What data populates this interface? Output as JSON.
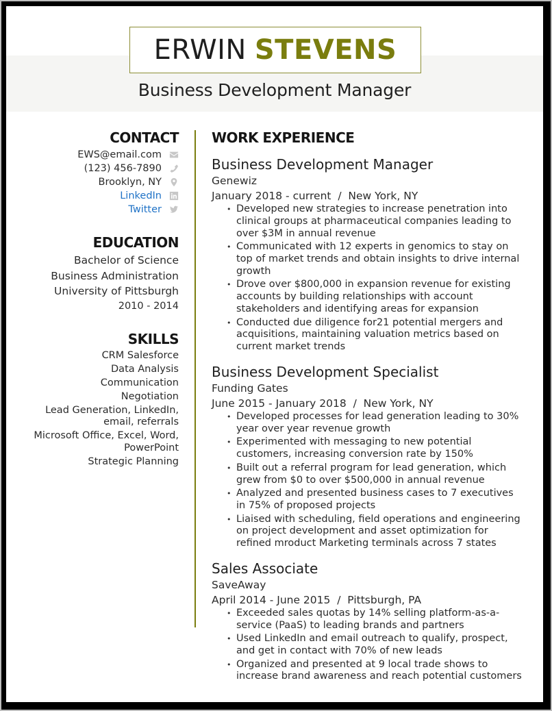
{
  "header": {
    "first_name": "ERWIN",
    "last_name": "STEVENS",
    "title": "Business Development Manager"
  },
  "colors": {
    "accent": "#7a7d0e",
    "link": "#1f72c6",
    "band": "#f5f5f3",
    "icon": "#c7c7c7"
  },
  "contact": {
    "heading": "CONTACT",
    "items": [
      {
        "text": "EWS@email.com",
        "icon": "envelope-icon"
      },
      {
        "text": "(123) 456-7890",
        "icon": "phone-icon"
      },
      {
        "text": "Brooklyn, NY",
        "icon": "map-pin-icon"
      },
      {
        "text": "LinkedIn",
        "icon": "linkedin-icon"
      },
      {
        "text": "Twitter",
        "icon": "twitter-icon"
      }
    ]
  },
  "education": {
    "heading": "EDUCATION",
    "degree": "Bachelor of Science",
    "major": "Business Administration",
    "school": "University of Pittsburgh",
    "years": "2010 - 2014"
  },
  "skills": {
    "heading": "SKILLS",
    "items": [
      "CRM Salesforce",
      "Data Analysis",
      "Communication",
      "Negotiation",
      "Lead Generation, LinkedIn, email, referrals",
      "Microsoft Office, Excel, Word, PowerPoint",
      "Strategic Planning"
    ]
  },
  "experience": {
    "heading": "WORK EXPERIENCE",
    "jobs": [
      {
        "title": "Business Development Manager",
        "company": "Genewiz",
        "dates": "January 2018 - current  /  New York, NY",
        "bullets": [
          "Developed new strategies to increase penetration into clinical groups at pharmaceutical companies leading to over $3M in annual revenue",
          "Communicated with 12 experts in genomics to stay on top of market trends and obtain insights to drive internal growth",
          "Drove over $800,000 in expansion revenue for existing accounts by building relationships with account stakeholders and identifying areas for expansion",
          "Conducted due diligence for21 potential mergers and acquisitions, maintaining valuation metrics based on current market trends"
        ]
      },
      {
        "title": "Business Development Specialist",
        "company": "Funding Gates",
        "dates": "June 2015 - January 2018  /  New York, NY",
        "bullets": [
          "Developed processes for lead generation leading to 30% year over year revenue growth",
          "Experimented with messaging to new potential customers, increasing conversion rate by 150%",
          "Built out a referral program for lead generation, which grew from $0 to over $500,000 in annual revenue",
          "Analyzed and presented business cases to 7 executives in 75% of proposed projects",
          "Liaised with scheduling, field operations and engineering on project development and asset optimization for refined mroduct Marketing terminals across 7 states"
        ]
      },
      {
        "title": "Sales Associate",
        "company": "SaveAway",
        "dates": "April 2014 - June 2015  /  Pittsburgh, PA",
        "bullets": [
          "Exceeded sales quotas by 14% selling platform-as-a-service (PaaS) to leading brands and partners",
          "Used LinkedIn and email outreach to qualify, prospect, and get in contact with 70% of new leads",
          "Organized and presented at 9 local trade shows to increase brand awareness and reach potential customers"
        ]
      }
    ]
  }
}
